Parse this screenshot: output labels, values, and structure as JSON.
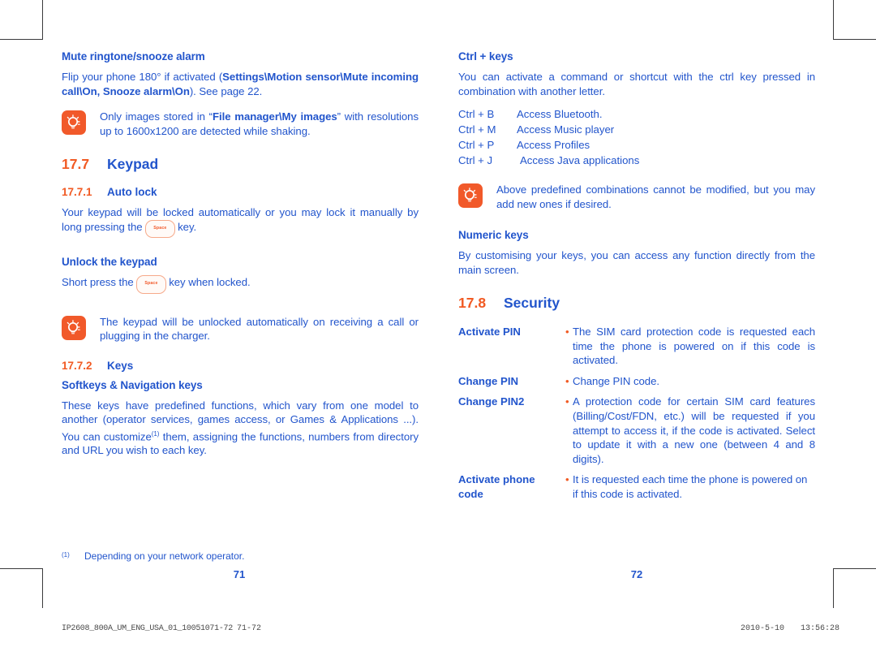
{
  "document": {
    "left_page": {
      "folio": "71",
      "mute_section": {
        "heading": "Mute ringtone/snooze alarm",
        "paragraph_pre": "Flip your phone 180° if activated (",
        "paragraph_bold": "Settings\\Motion sensor\\Mute incoming call\\On, Snooze alarm\\On",
        "paragraph_post": "). See page 22.",
        "tip": {
          "icon": "lightbulb-icon",
          "pre": "Only images stored in “",
          "bold": "File manager\\My images",
          "post": "” with resolutions up to 1600x1200 are detected while shaking."
        }
      },
      "keypad_section": {
        "number": "17.7",
        "title": "Keypad",
        "auto_lock": {
          "number": "17.7.1",
          "title": "Auto lock",
          "text_pre": "Your keypad will be locked automatically or you may lock it manually by long pressing the",
          "key_label": "Space",
          "text_post": "key."
        },
        "unlock": {
          "heading": "Unlock the keypad",
          "text_pre": "Short press the",
          "key_label": "Space",
          "text_post": "key when locked."
        },
        "unlock_tip": {
          "icon": "lightbulb-icon",
          "text": "The keypad will be unlocked automatically on receiving a call or plugging in the charger."
        },
        "keys": {
          "number": "17.7.2",
          "title": "Keys",
          "softkeys_heading": "Softkeys & Navigation keys",
          "softkeys_text_pre": "These keys have predefined functions, which vary from one model to another (operator services, games access, or Games & Applications ...). You can customize",
          "softkeys_footnote_marker": "(1)",
          "softkeys_text_post": "them, assigning the functions, numbers from directory and URL you wish to each key."
        }
      },
      "footnote": {
        "marker": "(1)",
        "text": "Depending on your network operator."
      }
    },
    "right_page": {
      "folio": "72",
      "ctrl_section": {
        "heading": "Ctrl + keys",
        "intro": "You can activate a command or shortcut with the ctrl key pressed in combination with another letter.",
        "shortcuts": [
          {
            "combo": "Ctrl + B",
            "action": "Access Bluetooth."
          },
          {
            "combo": "Ctrl + M",
            "action": "Access Music player"
          },
          {
            "combo": "Ctrl + P",
            "action": "Access Profiles"
          },
          {
            "combo": "Ctrl + J",
            "action": "Access Java applications"
          }
        ],
        "tip": {
          "icon": "lightbulb-icon",
          "text": "Above predefined combinations cannot be modified, but you may add new ones if desired."
        }
      },
      "numeric_keys": {
        "heading": "Numeric keys",
        "text": "By customising your keys, you can access any function directly from the main screen."
      },
      "security_section": {
        "number": "17.8",
        "title": "Security",
        "entries": [
          {
            "term": "Activate PIN",
            "description": "The SIM card protection code is requested each time the phone is powered on if this code is activated."
          },
          {
            "term": "Change PIN",
            "description": "Change PIN code."
          },
          {
            "term": "Change PIN2",
            "description": "A protection code for certain SIM card features (Billing/Cost/FDN, etc.) will be requested if you attempt to access it, if the code is activated. Select to update it with a new one (between 4 and 8 digits)."
          },
          {
            "term": "Activate phone code",
            "description": "It is requested each time the phone is powered on if this code is activated."
          }
        ]
      }
    }
  },
  "print_slug": {
    "filename": "IP2608_800A_UM_ENG_USA_01_10051071-72",
    "pages": "71-72",
    "date": "2010-5-10",
    "time": "13:56:28"
  },
  "colors": {
    "body_blue": "#2255cc",
    "accent_orange": "#f15a23",
    "tip_icon_bg": "#f1592a",
    "crop_mark": "#3a3a3c"
  }
}
